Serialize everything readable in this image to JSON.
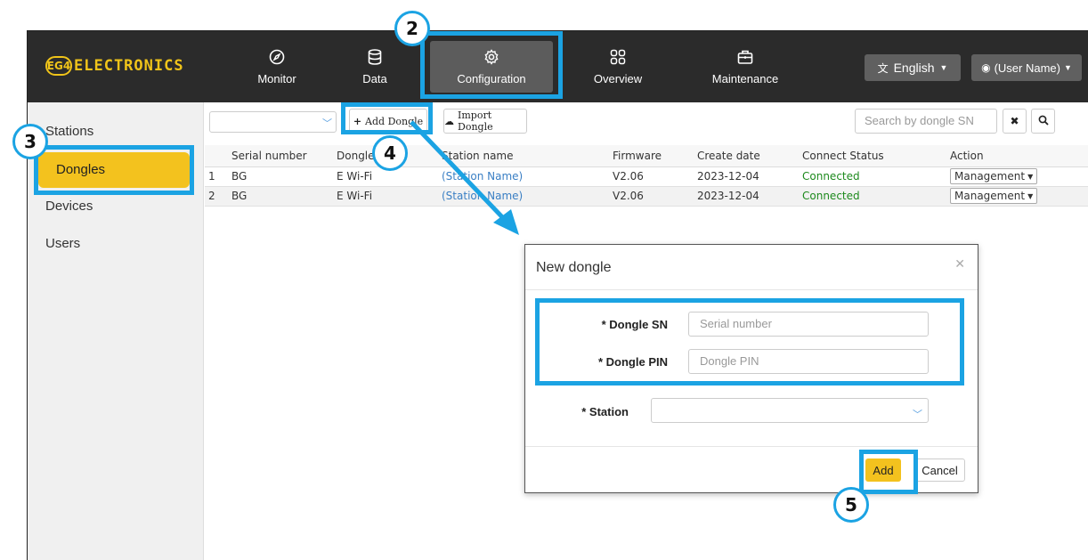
{
  "brand": {
    "ring": "EG4",
    "text": "ELECTRONICS",
    "accent": "#f0c419"
  },
  "nav": [
    {
      "label": "Monitor",
      "icon": "compass-icon"
    },
    {
      "label": "Data",
      "icon": "database-icon"
    },
    {
      "label": "Configuration",
      "icon": "gear-icon"
    },
    {
      "label": "Overview",
      "icon": "grid-icon"
    },
    {
      "label": "Maintenance",
      "icon": "toolbox-icon"
    }
  ],
  "header": {
    "language": "English",
    "user": "(User Name)"
  },
  "sidebar": {
    "items": [
      {
        "label": "Stations"
      },
      {
        "label": "Dongles"
      },
      {
        "label": "Devices"
      },
      {
        "label": "Users"
      }
    ]
  },
  "toolbar": {
    "add_dongle": "Add Dongle",
    "import_dongle": "Import Dongle",
    "search_placeholder": "Search by dongle SN"
  },
  "table": {
    "columns": [
      "",
      "Serial number",
      "Dongle",
      "Station name",
      "Firmware",
      "Create date",
      "Connect Status",
      "Action"
    ],
    "rows": [
      {
        "index": "1",
        "serial": "BG",
        "dongle": "E Wi-Fi",
        "station": "(Station Name)",
        "firmware": "V2.06",
        "date": "2023-12-04",
        "status": "Connected",
        "action": "Management"
      },
      {
        "index": "2",
        "serial": "BG",
        "dongle": "E Wi-Fi",
        "station": "(Station Name)",
        "firmware": "V2.06",
        "date": "2023-12-04",
        "status": "Connected",
        "action": "Management"
      }
    ]
  },
  "modal": {
    "title": "New dongle",
    "sn_label": "* Dongle SN",
    "sn_placeholder": "Serial number",
    "pin_label": "* Dongle PIN",
    "pin_placeholder": "Dongle PIN",
    "station_label": "* Station",
    "add": "Add",
    "cancel": "Cancel"
  },
  "callouts": {
    "c2": "2",
    "c3": "3",
    "c4": "4",
    "c5": "5"
  },
  "colors": {
    "highlight": "#1ba3e3",
    "primary_button": "#f3c21e",
    "topbar": "#2b2b2b"
  }
}
